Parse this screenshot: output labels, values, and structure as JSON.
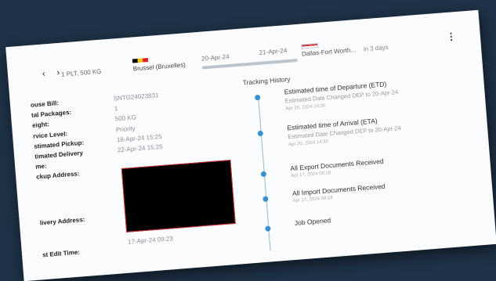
{
  "header": {
    "arrows": "‹ ›",
    "packages_weight": "1 PLT, 500 KG",
    "origin": "Brussel (Bruxelles)",
    "date_from": "20-Apr-24",
    "date_to": "21-Apr-24",
    "destination": "Dallas-Fort Worth...",
    "eta": "in 3 days",
    "more_icon": "vertical-dots-icon"
  },
  "details": [
    {
      "label": "ouse Bill:",
      "value": "SNTG24023831"
    },
    {
      "label": "tal Packages:",
      "value": "1"
    },
    {
      "label": "eight:",
      "value": "500 KG"
    },
    {
      "label": "rvice Level:",
      "value": "Priority"
    },
    {
      "label": "stimated Pickup:",
      "value": "18-Apr-24 15:25"
    },
    {
      "label": "timated Delivery",
      "value": "22-Apr-24 15:25"
    },
    {
      "label": "me:",
      "value": ""
    },
    {
      "label": "ckup Address:",
      "value": ""
    }
  ],
  "delivery_label": "livery Address:",
  "last_edit": {
    "label": "st Edit Time:",
    "value": "17-Apr-24 09:23"
  },
  "history": {
    "title": "Tracking History",
    "events": [
      {
        "title": "Estimated time of Departure (ETD)",
        "sub": "Estimated Date Changed DEP to 20-Apr-24",
        "date": "Apr 20, 2024 14:30"
      },
      {
        "title": "Estimated time of Arrival (ETA)",
        "sub": "Estimated Date Changed DEP to 20-Apr-24",
        "date": "Apr 20, 2024 14:30"
      },
      {
        "title": "All Export Documents Received",
        "sub": "",
        "date": "Apr 17, 2024 09:18"
      },
      {
        "title": "All Import Documents Received",
        "sub": "",
        "date": "Apr 17, 2024 09:18"
      },
      {
        "title": "Job Opened",
        "sub": "",
        "date": ""
      }
    ]
  },
  "colors": {
    "background": "#1f3247",
    "sheet": "#fbfcfd",
    "accent": "#3a8fd1",
    "redaction": "#000000"
  }
}
